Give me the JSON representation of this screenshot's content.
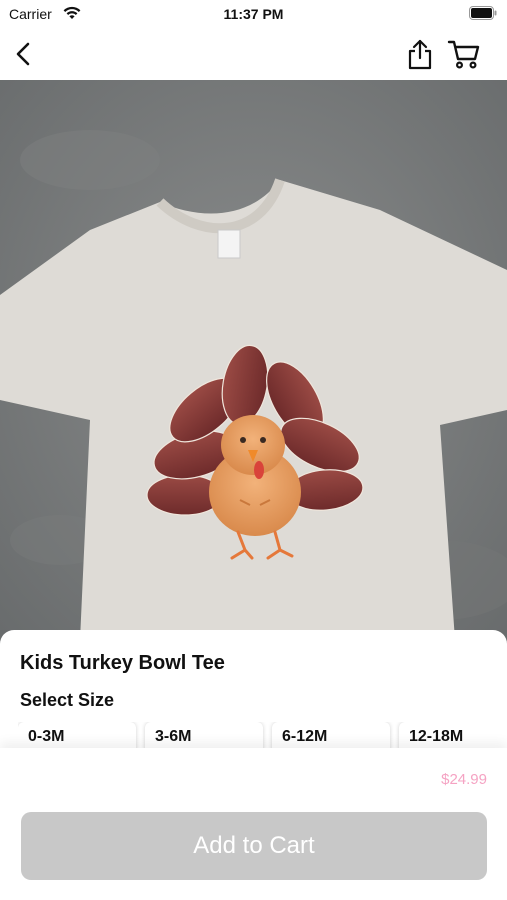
{
  "status_bar": {
    "carrier": "Carrier",
    "time": "11:37 PM"
  },
  "nav": {
    "back_icon": "chevron-left-icon",
    "share_icon": "share-icon",
    "cart_icon": "cart-icon"
  },
  "product": {
    "title": "Kids Turkey Bowl Tee",
    "select_size_label": "Select Size",
    "sizes": [
      "0-3M",
      "3-6M",
      "6-12M",
      "12-18M"
    ],
    "price": "$24.99",
    "price_color": "#f5a3c3"
  },
  "actions": {
    "add_to_cart_label": "Add to Cart",
    "button_color": "#c8c8c8"
  }
}
